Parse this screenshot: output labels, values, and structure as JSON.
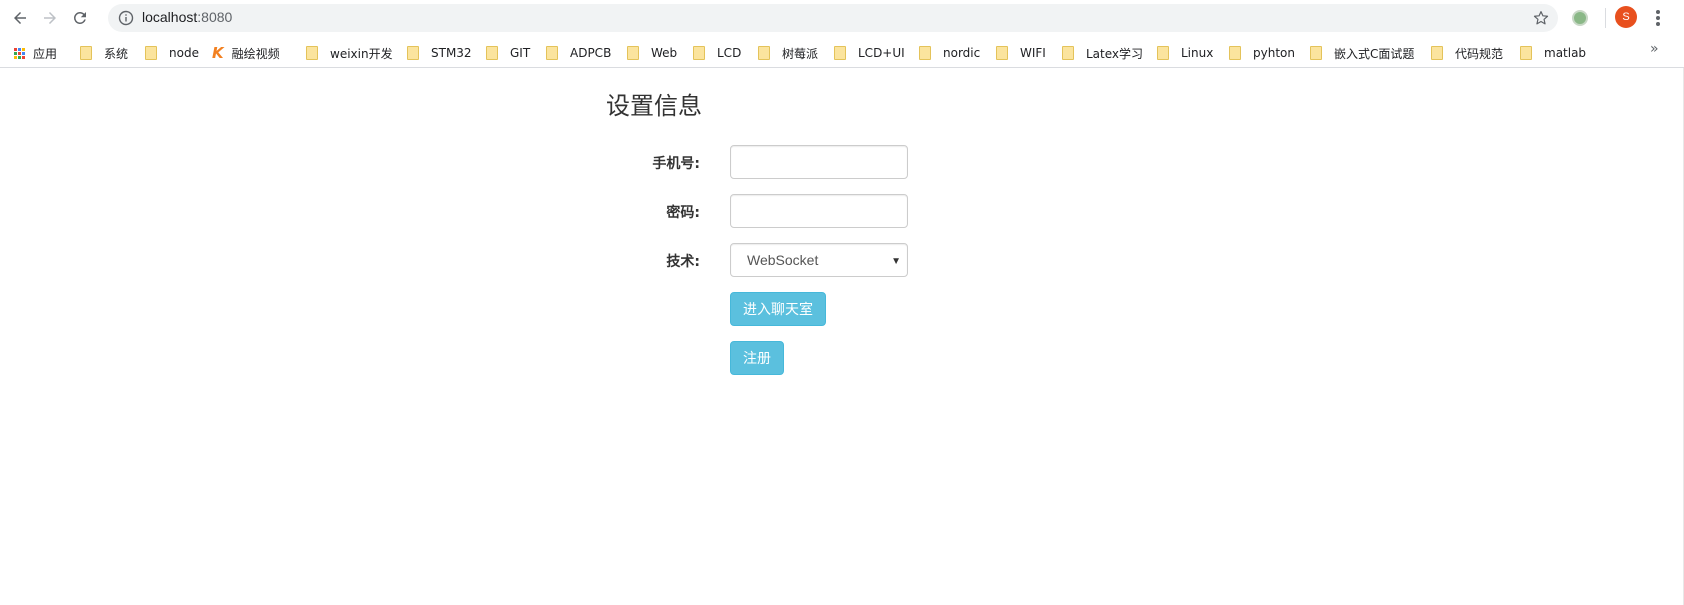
{
  "browser": {
    "url_host": "localhost",
    "url_port": ":8080",
    "avatar_letter": "S",
    "bookmarks": [
      {
        "label": "应用",
        "icon": "apps-icon"
      },
      {
        "label": "系统",
        "icon": "folder-icon"
      },
      {
        "label": "node",
        "icon": "folder-icon"
      },
      {
        "label": "融绘视频",
        "icon": "k-icon"
      },
      {
        "label": "weixin开发",
        "icon": "folder-icon"
      },
      {
        "label": "STM32",
        "icon": "folder-icon"
      },
      {
        "label": "GIT",
        "icon": "folder-icon"
      },
      {
        "label": "ADPCB",
        "icon": "folder-icon"
      },
      {
        "label": "Web",
        "icon": "folder-icon"
      },
      {
        "label": "LCD",
        "icon": "folder-icon"
      },
      {
        "label": "树莓派",
        "icon": "folder-icon"
      },
      {
        "label": "LCD+UI",
        "icon": "folder-icon"
      },
      {
        "label": "nordic",
        "icon": "folder-icon"
      },
      {
        "label": "WIFI",
        "icon": "folder-icon"
      },
      {
        "label": "Latex学习",
        "icon": "folder-icon"
      },
      {
        "label": "Linux",
        "icon": "folder-icon"
      },
      {
        "label": "pyhton",
        "icon": "folder-icon"
      },
      {
        "label": "嵌入式C面试题",
        "icon": "folder-icon"
      },
      {
        "label": "代码规范",
        "icon": "folder-icon"
      },
      {
        "label": "matlab",
        "icon": "folder-icon"
      }
    ],
    "more_label": "»"
  },
  "page": {
    "title": "设置信息",
    "phone_label": "手机号:",
    "phone_value": "",
    "password_label": "密码:",
    "password_value": "",
    "tech_label": "技术:",
    "tech_selected": "WebSocket",
    "enter_button": "进入聊天室",
    "register_button": "注册"
  },
  "colors": {
    "accent": "#5bc0de",
    "avatar": "#e8501e"
  }
}
